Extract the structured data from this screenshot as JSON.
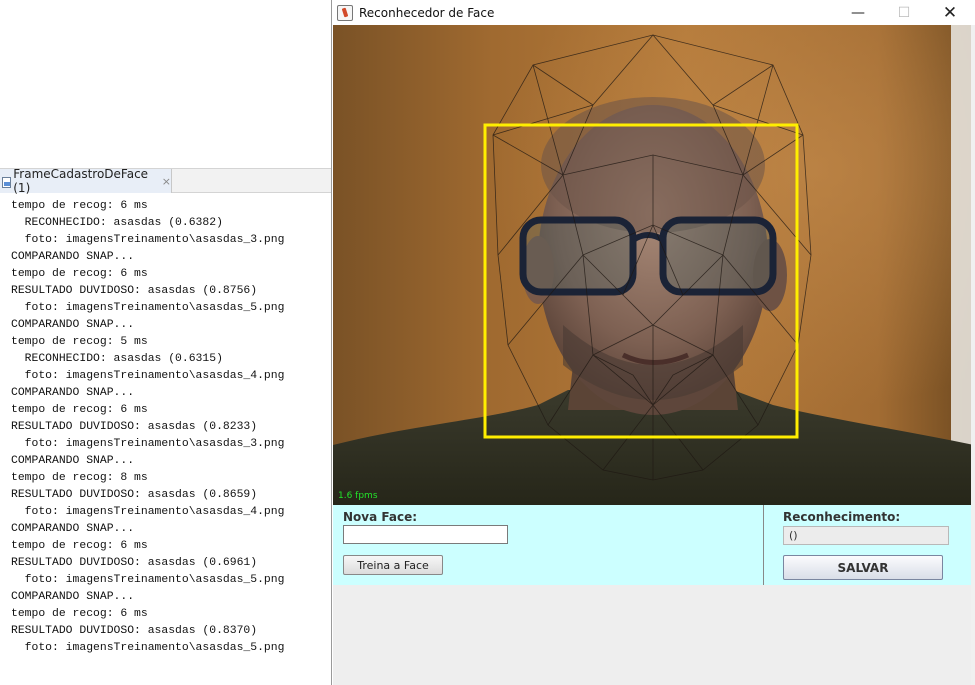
{
  "ide": {
    "console_tab": {
      "label": "FrameCadastroDeFace (1)",
      "close": "×"
    },
    "console_lines": [
      "tempo de recog: 6 ms",
      "  RECONHECIDO: asasdas (0.6382)",
      "  foto: imagensTreinamento\\asasdas_3.png",
      "COMPARANDO SNAP...",
      "tempo de recog: 6 ms",
      "RESULTADO DUVIDOSO: asasdas (0.8756)",
      "  foto: imagensTreinamento\\asasdas_5.png",
      "COMPARANDO SNAP...",
      "tempo de recog: 5 ms",
      "  RECONHECIDO: asasdas (0.6315)",
      "  foto: imagensTreinamento\\asasdas_4.png",
      "COMPARANDO SNAP...",
      "tempo de recog: 6 ms",
      "RESULTADO DUVIDOSO: asasdas (0.8233)",
      "  foto: imagensTreinamento\\asasdas_3.png",
      "COMPARANDO SNAP...",
      "tempo de recog: 8 ms",
      "RESULTADO DUVIDOSO: asasdas (0.8659)",
      "  foto: imagensTreinamento\\asasdas_4.png",
      "COMPARANDO SNAP...",
      "tempo de recog: 6 ms",
      "RESULTADO DUVIDOSO: asasdas (0.6961)",
      "  foto: imagensTreinamento\\asasdas_5.png",
      "COMPARANDO SNAP...",
      "tempo de recog: 6 ms",
      "RESULTADO DUVIDOSO: asasdas (0.8370)",
      "  foto: imagensTreinamento\\asasdas_5.png"
    ]
  },
  "window": {
    "title": "Reconhecedor de Face",
    "icon": "java-cup-icon",
    "controls": {
      "minimize": "—",
      "maximize": "☐",
      "close": "✕"
    }
  },
  "camera": {
    "fps": "1.6 fpms",
    "face_box_color": "#ffee00",
    "fps_color": "#22e22a"
  },
  "form": {
    "nova_face_label": "Nova Face:",
    "nova_face_value": "",
    "train_button": "Treina a Face",
    "reconhecimento_label": "Reconhecimento:",
    "reconhecimento_value": "()",
    "save_button": "SALVAR",
    "panel_color": "#ccffff"
  }
}
